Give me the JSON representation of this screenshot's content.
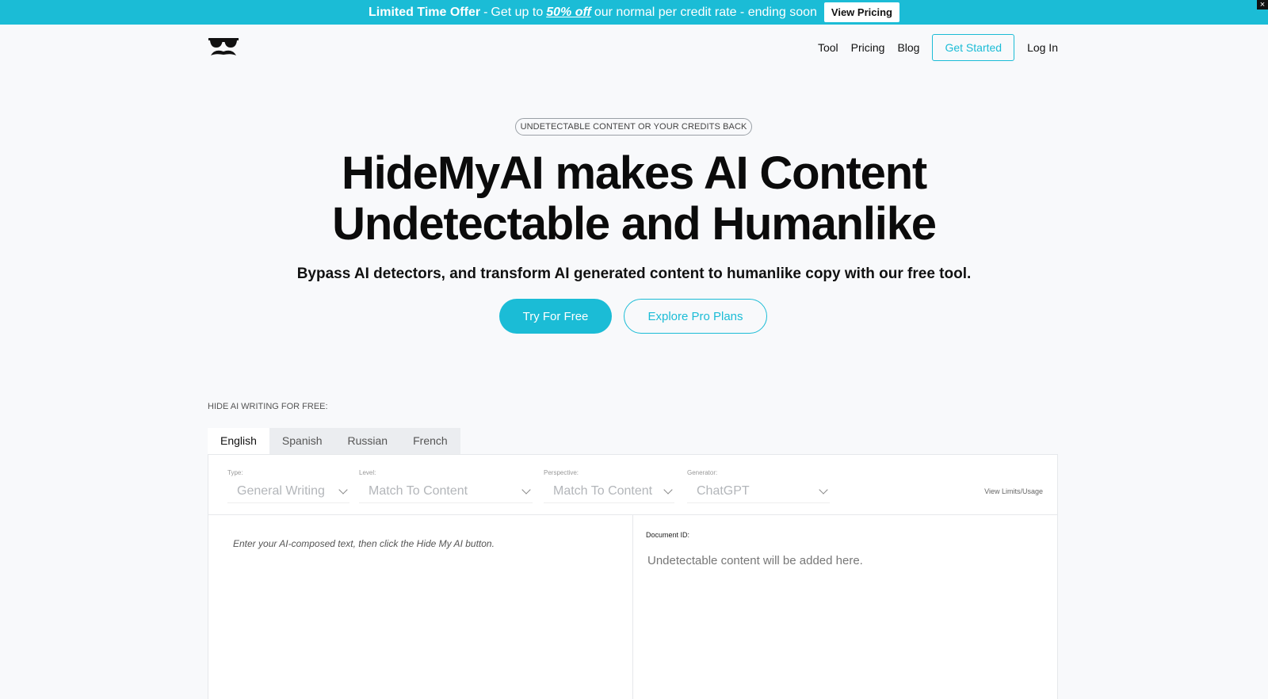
{
  "promo": {
    "lead": "Limited Time Offer",
    "separator": "-",
    "pre": "Get up to",
    "discount": "50% off",
    "post": "our normal per credit rate - ending soon",
    "button": "View Pricing",
    "close": "×"
  },
  "nav": {
    "items": [
      "Tool",
      "Pricing",
      "Blog"
    ],
    "get_started": "Get Started",
    "login": "Log In"
  },
  "hero": {
    "pill": "UNDETECTABLE CONTENT OR YOUR CREDITS BACK",
    "title_line1": "HideMyAI makes AI Content",
    "title_line2": "Undetectable and Humanlike",
    "subtitle": "Bypass AI detectors, and transform AI generated content to humanlike copy with our free tool.",
    "cta_primary": "Try For Free",
    "cta_secondary": "Explore Pro Plans"
  },
  "tool": {
    "section_label": "HIDE AI WRITING FOR FREE:",
    "tabs": [
      "English",
      "Spanish",
      "Russian",
      "French"
    ],
    "active_tab": "English",
    "fields": {
      "type": {
        "label": "Type:",
        "value": "General Writing"
      },
      "level": {
        "label": "Level:",
        "value": "Match To Content"
      },
      "perspective": {
        "label": "Perspective:",
        "value": "Match To Content"
      },
      "generator": {
        "label": "Generator:",
        "value": "ChatGPT"
      }
    },
    "view_limits": "View Limits/Usage",
    "input_placeholder": "Enter your AI-composed text, then click the Hide My AI button.",
    "document_id_label": "Document ID:",
    "output_placeholder": "Undetectable content will be added here."
  },
  "colors": {
    "accent": "#1bbcd6",
    "background": "#f8f9fb"
  }
}
